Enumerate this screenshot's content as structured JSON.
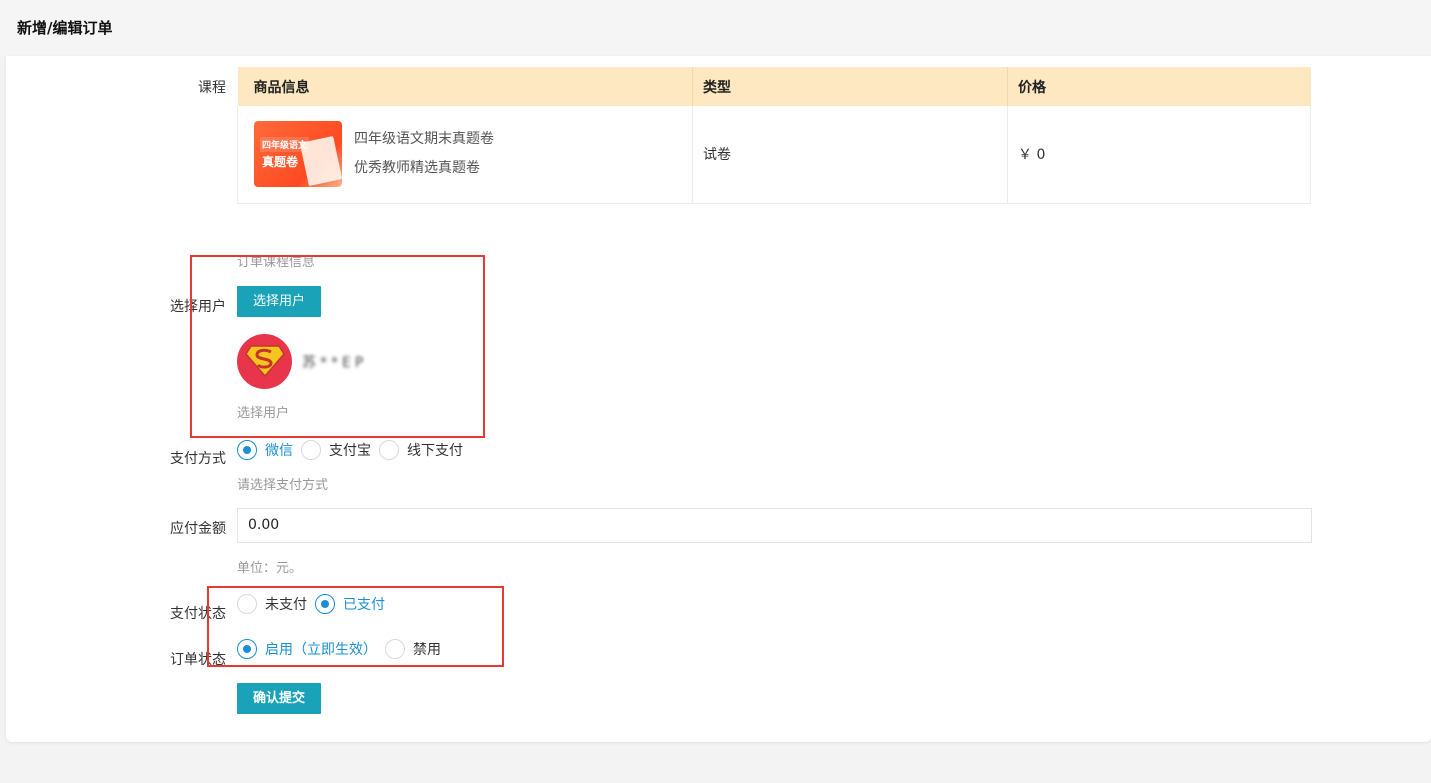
{
  "header": {
    "title": "新增/编辑订单"
  },
  "course": {
    "label": "课程",
    "columns": [
      "商品信息",
      "类型",
      "价格"
    ],
    "row": {
      "name": "四年级语文期末真题卷",
      "desc": "优秀教师精选真题卷",
      "type": "试卷",
      "price": "￥ 0",
      "thumb_text_top": "四年级语文",
      "thumb_text_main": "真题卷"
    },
    "hint": "订单课程信息"
  },
  "user": {
    "label": "选择用户",
    "button": "选择用户",
    "name": "苏**EP",
    "hint": "选择用户"
  },
  "payment": {
    "label": "支付方式",
    "options": [
      "微信",
      "支付宝",
      "线下支付"
    ],
    "selected": "微信",
    "hint": "请选择支付方式"
  },
  "amount": {
    "label": "应付金额",
    "value": "0.00",
    "hint": "单位：元。"
  },
  "pay_status": {
    "label": "支付状态",
    "options": [
      "未支付",
      "已支付"
    ],
    "selected": "已支付"
  },
  "order_status": {
    "label": "订单状态",
    "options": [
      "启用（立即生效）",
      "禁用"
    ],
    "selected": "启用（立即生效）"
  },
  "submit": {
    "label": "确认提交"
  },
  "colors": {
    "accent": "#1aa3b8",
    "radio": "#1a8fd6",
    "table_header": "#fde8c1",
    "highlight": "#e53935"
  }
}
